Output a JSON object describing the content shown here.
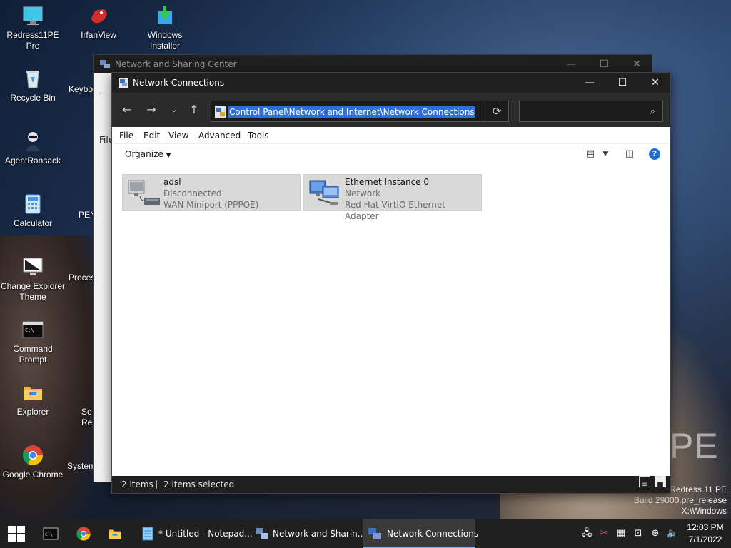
{
  "desktop": {
    "icons": [
      {
        "label": "Redress11PE Pre",
        "icon": "monitor-icon"
      },
      {
        "label": "IrfanView",
        "icon": "irfanview-icon"
      },
      {
        "label": "Windows Installer",
        "icon": "windows-installer-icon"
      },
      {
        "label": "Recycle Bin",
        "icon": "recycle-bin-icon"
      },
      {
        "label": "Keybo",
        "icon": "keyboard-icon"
      },
      {
        "label": "AgentRansack",
        "icon": "agentransack-icon"
      },
      {
        "label": "Calculator",
        "icon": "calculator-icon"
      },
      {
        "label": "PEN",
        "icon": "pen-icon"
      },
      {
        "label": "Change Explorer Theme",
        "icon": "theme-icon"
      },
      {
        "label": "Proces",
        "icon": "process-icon"
      },
      {
        "label": "Command Prompt",
        "icon": "cmd-icon"
      },
      {
        "label": "Explorer",
        "icon": "folder-icon"
      },
      {
        "label": "Se Res",
        "icon": "settings-icon"
      },
      {
        "label": "Google Chrome",
        "icon": "chrome-icon"
      },
      {
        "label": "System Re",
        "icon": "system-restore-icon"
      }
    ],
    "watermark": {
      "line1": "Redress 11 PE",
      "line2": "Build 29000.pre_release",
      "line3": "X:\\Windows"
    },
    "brand_mark": "PE"
  },
  "back_window": {
    "title": "Network and Sharing Center",
    "file_label": "File"
  },
  "window": {
    "title": "Network Connections",
    "address": "Control Panel\\Network and Internet\\Network Connections",
    "search_placeholder": "",
    "menu": [
      "File",
      "Edit",
      "View",
      "Advanced",
      "Tools"
    ],
    "organize_label": "Organize",
    "connections": [
      {
        "name": "adsl",
        "status": "Disconnected",
        "device": "WAN Miniport (PPPOE)",
        "icon": "dialup-connection-icon"
      },
      {
        "name": "Ethernet Instance 0",
        "status": "Network",
        "device": "Red Hat VirtIO Ethernet Adapter",
        "icon": "ethernet-connection-icon"
      }
    ],
    "status_bar": {
      "items_count": "2 items",
      "selected_count": "2 items selected"
    }
  },
  "taskbar": {
    "apps": [
      {
        "label": "",
        "icon": "cmd-icon"
      },
      {
        "label": "",
        "icon": "chrome-icon"
      },
      {
        "label": "",
        "icon": "folder-icon"
      },
      {
        "label": "* Untitled - Notepad...",
        "icon": "notepad-icon"
      },
      {
        "label": "Network and Sharin...",
        "icon": "network-sharing-icon"
      },
      {
        "label": "Network Connections",
        "icon": "network-connections-icon"
      }
    ],
    "clock": {
      "time": "12:03 PM",
      "date": "7/1/2022"
    }
  },
  "colors": {
    "accent": "#2f6fd8",
    "title_bar": "#202020",
    "taskbar": "#202020"
  }
}
